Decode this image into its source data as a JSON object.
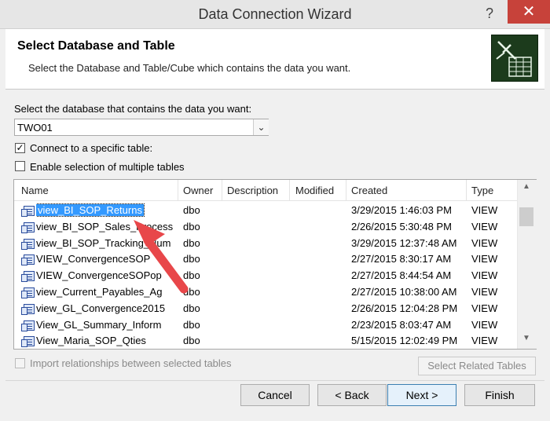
{
  "window": {
    "title": "Data Connection Wizard",
    "help_glyph": "?",
    "close_glyph": "✕"
  },
  "header": {
    "title": "Select Database and Table",
    "subtitle": "Select the Database and Table/Cube which contains the data you want."
  },
  "database": {
    "label": "Select the database that contains the data you want:",
    "value": "TWO01"
  },
  "options": {
    "connect_specific": {
      "label": "Connect to a specific table:",
      "checked": true
    },
    "multiple_tables": {
      "label": "Enable selection of multiple tables",
      "checked": false
    }
  },
  "table": {
    "columns": [
      "Name",
      "Owner",
      "Description",
      "Modified",
      "Created",
      "Type"
    ],
    "rows": [
      {
        "name": "view_BI_SOP_Returns",
        "owner": "dbo",
        "description": "",
        "modified": "",
        "created": "3/29/2015 1:46:03 PM",
        "type": "VIEW",
        "selected": true
      },
      {
        "name": "view_BI_SOP_Sales_Process",
        "owner": "dbo",
        "description": "",
        "modified": "",
        "created": "2/26/2015 5:30:48 PM",
        "type": "VIEW"
      },
      {
        "name": "view_BI_SOP_Tracking_Num",
        "owner": "dbo",
        "description": "",
        "modified": "",
        "created": "3/29/2015 12:37:48 AM",
        "type": "VIEW"
      },
      {
        "name": "VIEW_ConvergenceSOP",
        "owner": "dbo",
        "description": "",
        "modified": "",
        "created": "2/27/2015 8:30:17 AM",
        "type": "VIEW"
      },
      {
        "name": "VIEW_ConvergenceSOPop",
        "owner": "dbo",
        "description": "",
        "modified": "",
        "created": "2/27/2015 8:44:54 AM",
        "type": "VIEW"
      },
      {
        "name": "view_Current_Payables_Ag",
        "owner": "dbo",
        "description": "",
        "modified": "",
        "created": "2/27/2015 10:38:00 AM",
        "type": "VIEW"
      },
      {
        "name": "view_GL_Convergence2015",
        "owner": "dbo",
        "description": "",
        "modified": "",
        "created": "2/26/2015 12:04:28 PM",
        "type": "VIEW"
      },
      {
        "name": "View_GL_Summary_Inform",
        "owner": "dbo",
        "description": "",
        "modified": "",
        "created": "2/23/2015 8:03:47 AM",
        "type": "VIEW"
      },
      {
        "name": "View_Maria_SOP_Qties",
        "owner": "dbo",
        "description": "",
        "modified": "",
        "created": "5/15/2015 12:02:49 PM",
        "type": "VIEW"
      }
    ]
  },
  "bottom": {
    "import_relationships": {
      "label": "Import relationships between selected tables",
      "checked": false,
      "enabled": false
    },
    "select_related": "Select Related Tables",
    "cancel": "Cancel",
    "back": "< Back",
    "next": "Next >",
    "finish": "Finish"
  },
  "colors": {
    "selection": "#3399ff",
    "close_button": "#c7423a",
    "arrow": "#e8474a"
  }
}
